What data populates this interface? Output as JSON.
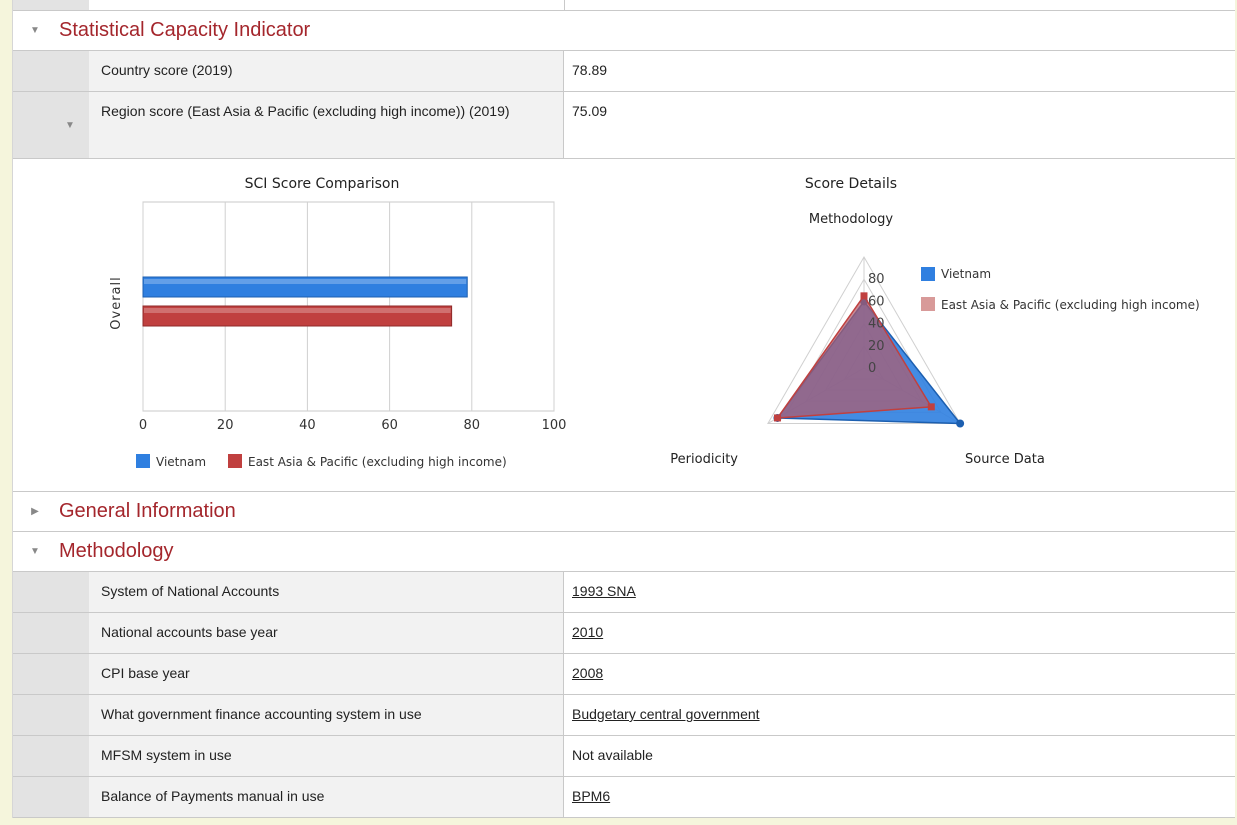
{
  "sections": {
    "sci": {
      "title": "Statistical Capacity Indicator"
    },
    "general": {
      "title": "General Information"
    },
    "methodology": {
      "title": "Methodology"
    }
  },
  "sci_rows": [
    {
      "label": "Country score (2019)",
      "value": "78.89"
    },
    {
      "label": "Region score (East Asia & Pacific (excluding high income)) (2019)",
      "value": "75.09"
    }
  ],
  "methodology_rows": [
    {
      "label": "System of National Accounts",
      "value": "1993 SNA"
    },
    {
      "label": "National accounts base year",
      "value": "2010"
    },
    {
      "label": "CPI base year",
      "value": "2008"
    },
    {
      "label": "What government finance accounting system in use",
      "value": "Budgetary central government"
    },
    {
      "label": "MFSM system in use",
      "value": "Not available"
    },
    {
      "label": "Balance of Payments manual in use",
      "value": "BPM6"
    }
  ],
  "colors": {
    "section_title": "#a4262c",
    "vietnam": "#2f7fe0",
    "region": "#c0403f"
  },
  "chart_data": [
    {
      "type": "bar",
      "title": "SCI Score Comparison",
      "categories": [
        "Overall"
      ],
      "series": [
        {
          "name": "Vietnam",
          "values": [
            78.89
          ]
        },
        {
          "name": "East Asia & Pacific (excluding high income)",
          "values": [
            75.09
          ]
        }
      ],
      "xlim": [
        0,
        100
      ],
      "xticks": [
        "0",
        "20",
        "40",
        "60",
        "80",
        "100"
      ],
      "grid": true,
      "legend": "bottom"
    },
    {
      "type": "radar",
      "title": "Score Details",
      "axes": [
        "Methodology",
        "Source Data",
        "Periodicity"
      ],
      "rticks": [
        "0",
        "20",
        "40",
        "60",
        "80"
      ],
      "series": [
        {
          "name": "Vietnam",
          "values": [
            60,
            100,
            90
          ]
        },
        {
          "name": "East Asia & Pacific (excluding high income)",
          "values": [
            65,
            70,
            90
          ]
        }
      ],
      "legend": "right"
    }
  ]
}
